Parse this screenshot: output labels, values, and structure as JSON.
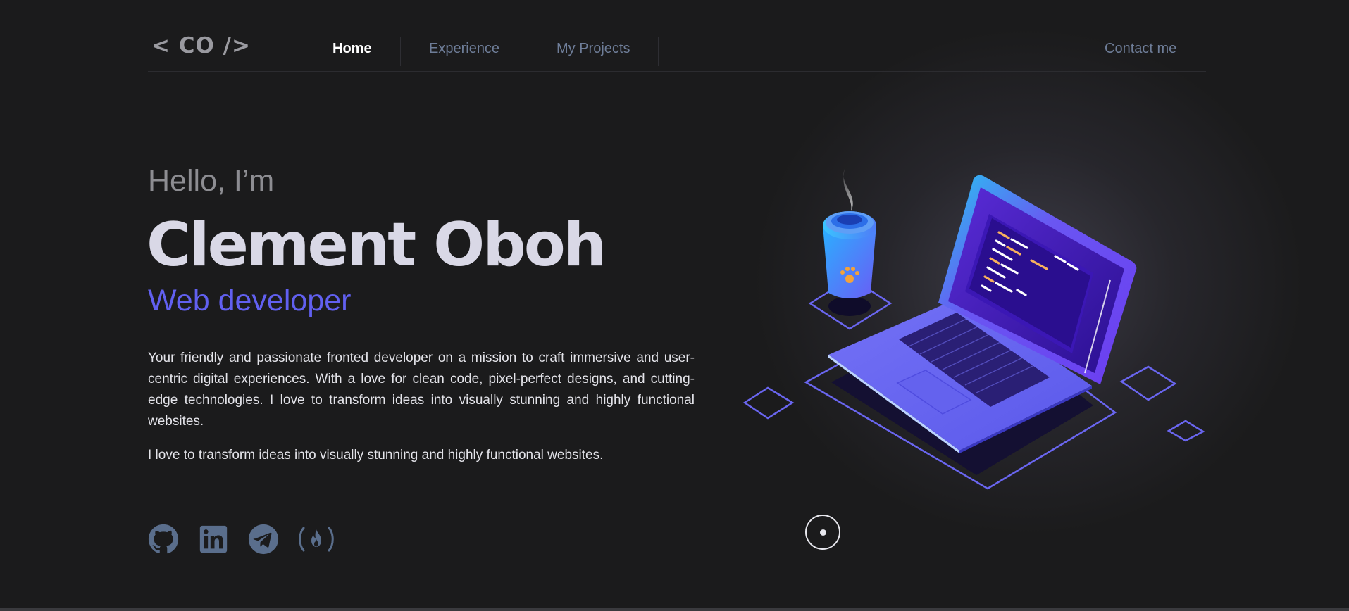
{
  "nav": {
    "logo": "< CO />",
    "links": [
      {
        "label": "Home",
        "active": true
      },
      {
        "label": "Experience",
        "active": false
      },
      {
        "label": "My Projects",
        "active": false
      }
    ],
    "contact": "Contact me"
  },
  "hero": {
    "greeting": "Hello, I’m",
    "name": "Clement Oboh",
    "role": "Web developer",
    "bio": "Your friendly and passionate fronted developer on a mission to craft immersive and user-centric digital experiences. With a love for clean code, pixel-perfect designs, and cutting-edge technologies. I love to transform ideas into visually stunning and highly functional websites.",
    "bio_short": "I love to transform ideas into visually stunning and highly functional websites."
  },
  "social": [
    {
      "icon": "github-icon"
    },
    {
      "icon": "linkedin-icon"
    },
    {
      "icon": "telegram-icon"
    },
    {
      "icon": "freecodecamp-icon"
    }
  ],
  "colors": {
    "background": "#1b1b1c",
    "accent": "#6160f0",
    "nav_link": "#6e7d98",
    "name": "#d9d8e6",
    "social_icon": "#5a6e8c"
  }
}
